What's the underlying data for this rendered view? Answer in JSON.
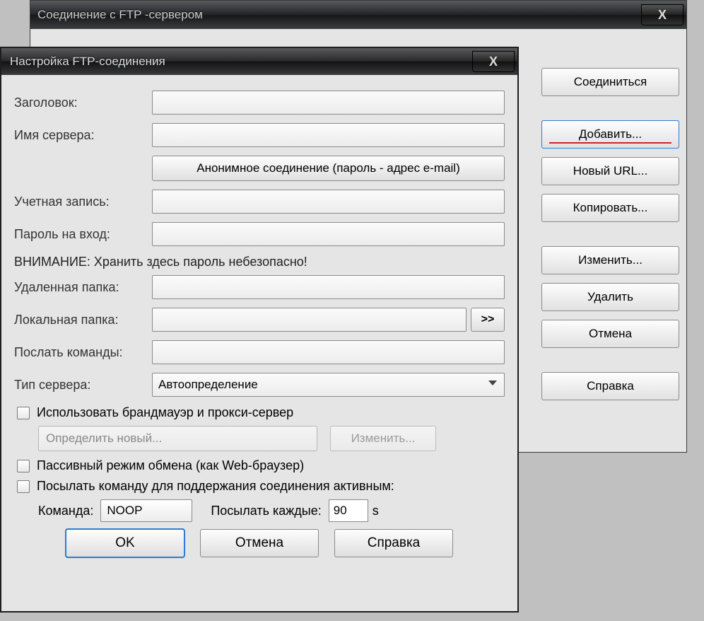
{
  "parent": {
    "title": "Соединение с FTP -сервером"
  },
  "sidebar": {
    "connect": "Соединиться",
    "add": "Добавить...",
    "new_url": "Новый URL...",
    "copy": "Копировать...",
    "edit": "Изменить...",
    "delete": "Удалить",
    "cancel": "Отмена",
    "help": "Справка"
  },
  "child": {
    "title": "Настройка FTP-соединения",
    "labels": {
      "title_field": "Заголовок:",
      "server": "Имя сервера:",
      "anon_btn": "Анонимное соединение (пароль - адрес e-mail)",
      "account": "Учетная запись:",
      "password": "Пароль на вход:",
      "warning": "ВНИМАНИЕ: Хранить здесь пароль небезопасно!",
      "remote": "Удаленная папка:",
      "local": "Локальная папка:",
      "commands": "Послать команды:",
      "server_type": "Тип сервера:",
      "server_type_value": "Автоопределение",
      "use_firewall": "Использовать брандмауэр и прокси-сервер",
      "firewall_select": "Определить новый...",
      "firewall_edit": "Изменить...",
      "passive": "Пассивный режим обмена (как Web-браузер)",
      "keepalive": "Посылать команду для поддержания соединения активным:",
      "command_label": "Команда:",
      "command_value": "NOOP",
      "interval_label": "Посылать каждые:",
      "interval_value": "90",
      "interval_unit": "s",
      "arrow_btn": ">>"
    },
    "buttons": {
      "ok": "OK",
      "cancel": "Отмена",
      "help": "Справка"
    },
    "values": {
      "title_field": "",
      "server": "",
      "account": "",
      "password": "",
      "remote": "",
      "local": "",
      "commands": ""
    }
  }
}
